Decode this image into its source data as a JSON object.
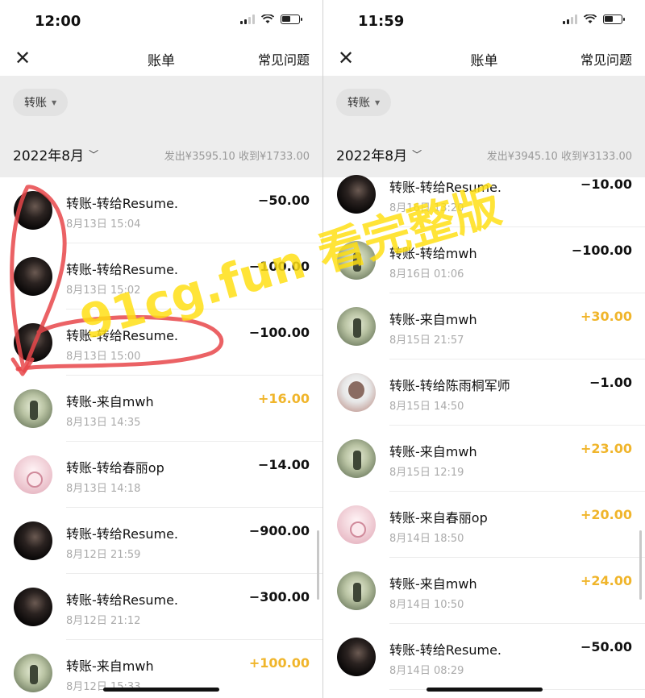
{
  "left": {
    "status": {
      "time": "12:00"
    },
    "nav": {
      "title": "账单",
      "faq": "常见问题"
    },
    "filter": {
      "label": "转账"
    },
    "month": {
      "label": "2022年8月",
      "summary": "发出¥3595.10  收到¥1733.00"
    },
    "rows": [
      {
        "title": "转账-转给Resume.",
        "time": "8月13日 15:04",
        "amount": "−50.00",
        "income": false,
        "avatar": "dark"
      },
      {
        "title": "转账-转给Resume.",
        "time": "8月13日 15:02",
        "amount": "−100.00",
        "income": false,
        "avatar": "dark"
      },
      {
        "title": "转账-转给Resume.",
        "time": "8月13日 15:00",
        "amount": "−100.00",
        "income": false,
        "avatar": "dark"
      },
      {
        "title": "转账-来自mwh",
        "time": "8月13日 14:35",
        "amount": "+16.00",
        "income": true,
        "avatar": "green"
      },
      {
        "title": "转账-转给春丽op",
        "time": "8月13日 14:18",
        "amount": "−14.00",
        "income": false,
        "avatar": "pink"
      },
      {
        "title": "转账-转给Resume.",
        "time": "8月12日 21:59",
        "amount": "−900.00",
        "income": false,
        "avatar": "dark"
      },
      {
        "title": "转账-转给Resume.",
        "time": "8月12日 21:12",
        "amount": "−300.00",
        "income": false,
        "avatar": "dark"
      },
      {
        "title": "转账-来自mwh",
        "time": "8月12日 15:33",
        "amount": "+100.00",
        "income": true,
        "avatar": "green"
      }
    ]
  },
  "right": {
    "status": {
      "time": "11:59"
    },
    "nav": {
      "title": "账单",
      "faq": "常见问题"
    },
    "filter": {
      "label": "转账"
    },
    "month": {
      "label": "2022年8月",
      "summary": "发出¥3945.10  收到¥3133.00"
    },
    "rows": [
      {
        "title": "转账-转给Resume.",
        "time": "8月16日 13:20",
        "amount": "−10.00",
        "income": false,
        "avatar": "dark"
      },
      {
        "title": "转账-转给mwh",
        "time": "8月16日 01:06",
        "amount": "−100.00",
        "income": false,
        "avatar": "green"
      },
      {
        "title": "转账-来自mwh",
        "time": "8月15日 21:57",
        "amount": "+30.00",
        "income": true,
        "avatar": "green"
      },
      {
        "title": "转账-转给陈雨桐军师",
        "time": "8月15日 14:50",
        "amount": "−1.00",
        "income": false,
        "avatar": "person"
      },
      {
        "title": "转账-来自mwh",
        "time": "8月15日 12:19",
        "amount": "+23.00",
        "income": true,
        "avatar": "green"
      },
      {
        "title": "转账-来自春丽op",
        "time": "8月14日 18:50",
        "amount": "+20.00",
        "income": true,
        "avatar": "pink"
      },
      {
        "title": "转账-来自mwh",
        "time": "8月14日 10:50",
        "amount": "+24.00",
        "income": true,
        "avatar": "green"
      },
      {
        "title": "转账-转给Resume.",
        "time": "8月14日 08:29",
        "amount": "−50.00",
        "income": false,
        "avatar": "dark"
      }
    ]
  },
  "watermark": "91cg.fun 看完整版",
  "colors": {
    "income": "#f0b52b",
    "header_bg": "#ededed",
    "watermark": "#ffdd00",
    "annotation": "#e8474a"
  }
}
